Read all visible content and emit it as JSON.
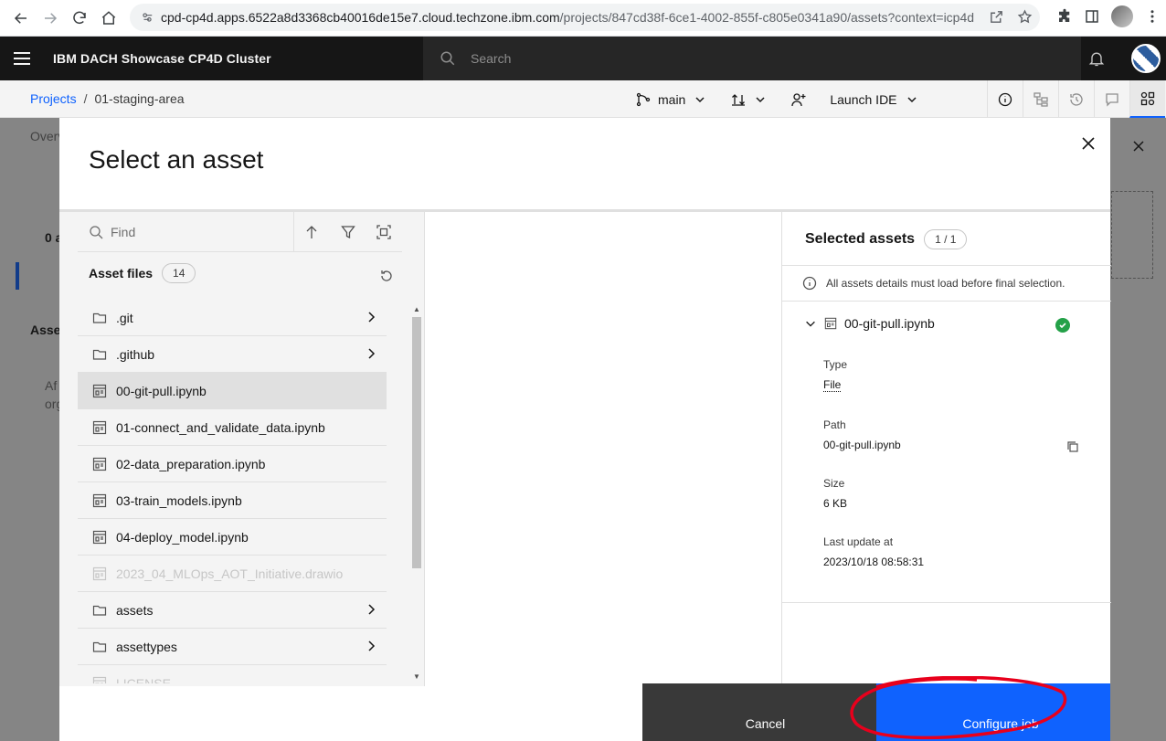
{
  "browser": {
    "url_host": "cpd-cp4d.apps.6522a8d3368cb40016de15e7.cloud.techzone.ibm.com",
    "url_path": "/projects/847cd38f-6ce1-4002-855f-c805e0341a90/assets?context=icp4d..."
  },
  "header": {
    "product_name": "IBM DACH Showcase CP4D Cluster",
    "search_placeholder": "Search"
  },
  "project_bar": {
    "breadcrumb_root": "Projects",
    "breadcrumb_sep": "/",
    "breadcrumb_current": "01-staging-area",
    "branch": "main",
    "launch_ide": "Launch IDE"
  },
  "behind": {
    "tab_overview": "Overv",
    "count_text": "0 a",
    "section_title": "Asse",
    "desc_line1": "Af",
    "desc_line2": "org"
  },
  "modal": {
    "title": "Select an asset",
    "find_placeholder": "Find",
    "asset_files_label": "Asset files",
    "asset_files_count": "14",
    "files": [
      {
        "name": ".git",
        "type": "folder",
        "state": "normal"
      },
      {
        "name": ".github",
        "type": "folder",
        "state": "normal"
      },
      {
        "name": "00-git-pull.ipynb",
        "type": "notebook",
        "state": "selected"
      },
      {
        "name": "01-connect_and_validate_data.ipynb",
        "type": "notebook",
        "state": "normal"
      },
      {
        "name": "02-data_preparation.ipynb",
        "type": "notebook",
        "state": "normal"
      },
      {
        "name": "03-train_models.ipynb",
        "type": "notebook",
        "state": "normal"
      },
      {
        "name": "04-deploy_model.ipynb",
        "type": "notebook",
        "state": "normal"
      },
      {
        "name": "2023_04_MLOps_AOT_Initiative.drawio",
        "type": "file",
        "state": "disabled"
      },
      {
        "name": "assets",
        "type": "folder",
        "state": "normal"
      },
      {
        "name": "assettypes",
        "type": "folder",
        "state": "normal"
      },
      {
        "name": "LICENSE",
        "type": "file",
        "state": "disabled"
      }
    ],
    "selected_title": "Selected assets",
    "selected_count": "1 / 1",
    "notice": "All assets details must load before final selection.",
    "selected_asset": {
      "name": "00-git-pull.ipynb",
      "type_label": "Type",
      "type_value": "File",
      "path_label": "Path",
      "path_value": "00-git-pull.ipynb",
      "size_label": "Size",
      "size_value": "6 KB",
      "updated_label": "Last update at",
      "updated_value": "2023/10/18 08:58:31"
    },
    "cancel_label": "Cancel",
    "configure_label": "Configure job"
  },
  "colors": {
    "primary": "#0f62fe",
    "header_bg": "#161616",
    "success": "#24a148",
    "annotation": "#e8001c"
  }
}
